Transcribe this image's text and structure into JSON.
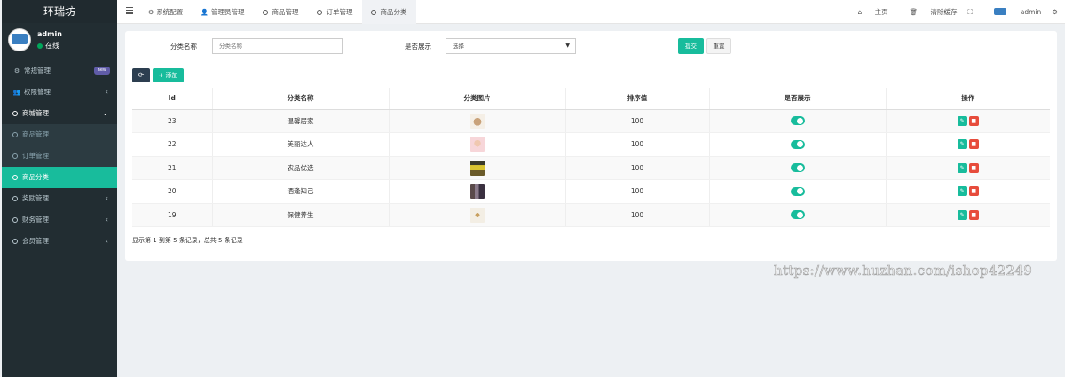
{
  "app": {
    "brand": "环瑞坊"
  },
  "user": {
    "name": "admin",
    "status": "在线",
    "status_color": "#00a65a"
  },
  "sidebar": {
    "items": [
      {
        "label": "常规管理",
        "icon": "cogs-icon",
        "badge": "new"
      },
      {
        "label": "权限管理",
        "icon": "users-icon"
      },
      {
        "label": "商城管理",
        "icon": "circle-icon",
        "expanded": true
      },
      {
        "label": "商品管理",
        "icon": "circle-icon"
      },
      {
        "label": "订单管理",
        "icon": "circle-icon"
      },
      {
        "label": "商品分类",
        "icon": "circle-icon",
        "active": true
      },
      {
        "label": "奖励管理",
        "icon": "circle-icon"
      },
      {
        "label": "财务管理",
        "icon": "circle-icon"
      },
      {
        "label": "会员管理",
        "icon": "circle-icon"
      }
    ]
  },
  "topbar": {
    "tabs": [
      {
        "label": "系统配置",
        "icon": "gear-icon"
      },
      {
        "label": "管理员管理",
        "icon": "user-icon"
      },
      {
        "label": "商品管理",
        "icon": "circle-icon"
      },
      {
        "label": "订单管理",
        "icon": "circle-icon"
      },
      {
        "label": "商品分类",
        "icon": "circle-icon",
        "active": true
      }
    ],
    "home": "主页",
    "clear_cache": "清除缓存",
    "admin": "admin"
  },
  "filter": {
    "name_label": "分类名称",
    "name_placeholder": "分类名称",
    "show_label": "是否展示",
    "show_value": "选择",
    "submit": "提交",
    "reset": "重置"
  },
  "toolbar": {
    "add": "添加"
  },
  "table": {
    "columns": [
      "Id",
      "分类名称",
      "分类图片",
      "排序值",
      "是否展示",
      "操作"
    ],
    "rows": [
      {
        "id": "23",
        "name": "温馨居家",
        "sort": "100",
        "shown": true
      },
      {
        "id": "22",
        "name": "美丽达人",
        "sort": "100",
        "shown": true
      },
      {
        "id": "21",
        "name": "农品优选",
        "sort": "100",
        "shown": true
      },
      {
        "id": "20",
        "name": "酒逢知己",
        "sort": "100",
        "shown": true
      },
      {
        "id": "19",
        "name": "保健养生",
        "sort": "100",
        "shown": true
      }
    ]
  },
  "pagination": {
    "summary": "显示第 1 到第 5 条记录，总共 5 条记录"
  },
  "watermark": "https://www.huzhan.com/ishop42249",
  "colors": {
    "accent": "#18bc9c",
    "danger": "#e74c3c",
    "sidebar": "#222d32"
  }
}
